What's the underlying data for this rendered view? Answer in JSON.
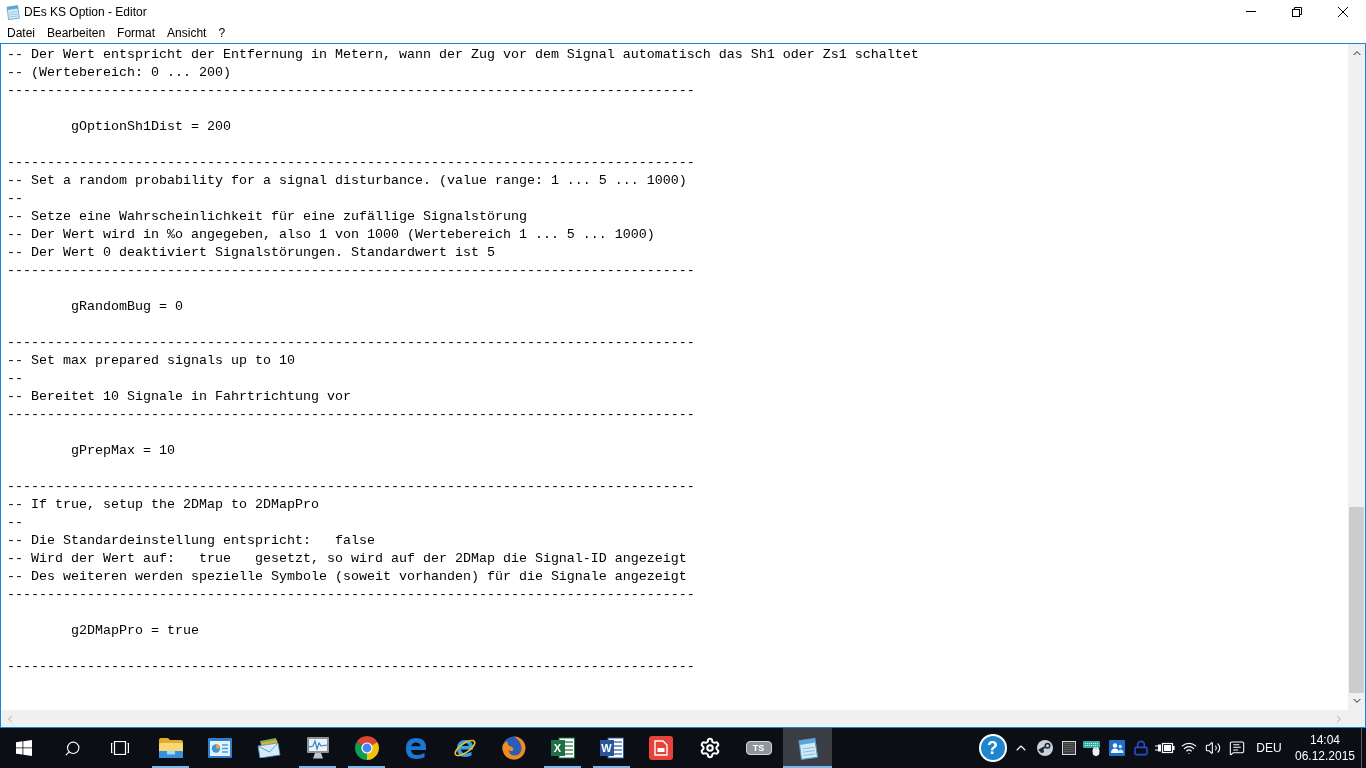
{
  "window": {
    "title": "DEs KS Option - Editor"
  },
  "menu": [
    "Datei",
    "Bearbeiten",
    "Format",
    "Ansicht",
    "?"
  ],
  "editor": {
    "lines": [
      {
        "kind": "comment",
        "text": "-- Der Wert entspricht der Entfernung in Metern, wann der Zug vor dem Signal automatisch das Sh1 oder Zs1 schaltet"
      },
      {
        "kind": "comment",
        "text": "-- (Wertebereich: 0 ... 200)"
      },
      {
        "kind": "comment",
        "text": "--------------------------------------------------------------------------------------"
      },
      {
        "kind": "blank"
      },
      {
        "kind": "setting",
        "text": "gOptionSh1Dist = 200"
      },
      {
        "kind": "blank"
      },
      {
        "kind": "comment",
        "text": "--------------------------------------------------------------------------------------"
      },
      {
        "kind": "comment",
        "text": "-- Set a random probability for a signal disturbance. (value range: 1 ... 5 ... 1000)"
      },
      {
        "kind": "comment",
        "text": "--"
      },
      {
        "kind": "comment",
        "text": "-- Setze eine Wahrscheinlichkeit für eine zufällige Signalstörung"
      },
      {
        "kind": "comment",
        "text": "-- Der Wert wird in %o angegeben, also 1 von 1000 (Wertebereich 1 ... 5 ... 1000)"
      },
      {
        "kind": "comment",
        "text": "-- Der Wert 0 deaktiviert Signalstörungen. Standardwert ist 5"
      },
      {
        "kind": "comment",
        "text": "--------------------------------------------------------------------------------------"
      },
      {
        "kind": "blank"
      },
      {
        "kind": "setting",
        "text": "gRandomBug = 0"
      },
      {
        "kind": "blank"
      },
      {
        "kind": "comment",
        "text": "--------------------------------------------------------------------------------------"
      },
      {
        "kind": "comment",
        "text": "-- Set max prepared signals up to 10"
      },
      {
        "kind": "comment",
        "text": "--"
      },
      {
        "kind": "comment",
        "text": "-- Bereitet 10 Signale in Fahrtrichtung vor"
      },
      {
        "kind": "comment",
        "text": "--------------------------------------------------------------------------------------"
      },
      {
        "kind": "blank"
      },
      {
        "kind": "setting",
        "text": "gPrepMax = 10"
      },
      {
        "kind": "blank"
      },
      {
        "kind": "comment",
        "text": "--------------------------------------------------------------------------------------"
      },
      {
        "kind": "comment",
        "text": "-- If true, setup the 2DMap to 2DMapPro"
      },
      {
        "kind": "comment",
        "text": "--"
      },
      {
        "kind": "comment",
        "text": "-- Die Standardeinstellung entspricht:   false"
      },
      {
        "kind": "comment",
        "text": "-- Wird der Wert auf:   true   gesetzt, so wird auf der 2DMap die Signal-ID angezeigt"
      },
      {
        "kind": "comment",
        "text": "-- Des weiteren werden spezielle Symbole (soweit vorhanden) für die Signale angezeigt"
      },
      {
        "kind": "comment",
        "text": "--------------------------------------------------------------------------------------"
      },
      {
        "kind": "blank"
      },
      {
        "kind": "setting",
        "text": "g2DMapPro = true"
      },
      {
        "kind": "blank"
      },
      {
        "kind": "comment",
        "text": "--------------------------------------------------------------------------------------"
      }
    ]
  },
  "taskbar": {
    "apps": [
      {
        "kind": "folder",
        "running": true,
        "selected": false
      },
      {
        "kind": "chart-window",
        "running": false,
        "selected": false
      },
      {
        "kind": "envelope",
        "running": false,
        "selected": false
      },
      {
        "kind": "monitor",
        "running": true,
        "selected": false
      },
      {
        "kind": "ring-browser",
        "running": true,
        "selected": false
      },
      {
        "kind": "e-browser",
        "running": false,
        "selected": false
      },
      {
        "kind": "orbit-browser",
        "running": false,
        "selected": false
      },
      {
        "kind": "fox-globe",
        "running": false,
        "selected": false
      },
      {
        "kind": "spreadsheet",
        "label": "X",
        "running": true,
        "selected": false
      },
      {
        "kind": "word-doc",
        "label": "W",
        "running": true,
        "selected": false
      },
      {
        "kind": "document-tile",
        "running": false,
        "selected": false
      },
      {
        "kind": "gear",
        "running": false,
        "selected": false
      },
      {
        "kind": "pill-logo",
        "label": "TS",
        "running": false,
        "selected": false
      },
      {
        "kind": "notepad",
        "running": true,
        "selected": true
      }
    ],
    "tray": {
      "help": "?",
      "language": "DEU",
      "time": "14:04",
      "date": "06.12.2015"
    }
  }
}
